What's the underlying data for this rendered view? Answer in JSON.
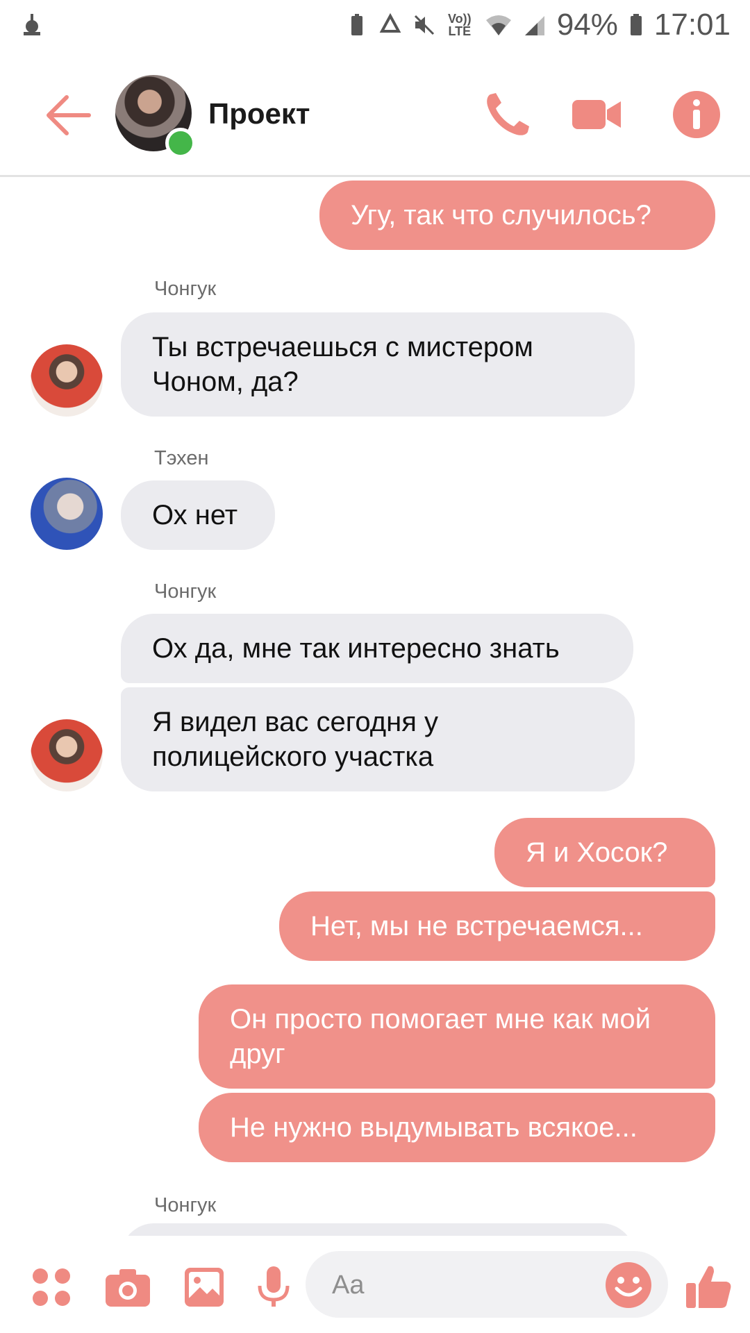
{
  "status_bar": {
    "battery": "94%",
    "time": "17:01",
    "network": "Vo)) LTE"
  },
  "header": {
    "title": "Проект",
    "online": true
  },
  "colors": {
    "accent": "#f0918a",
    "incoming_bubble": "#ebebef",
    "online": "#44b649"
  },
  "messages": [
    {
      "from": "me",
      "text": "Угу, так что случилось?"
    },
    {
      "from": "Чонгук",
      "text": "Ты встречаешься с мистером Чоном, да?"
    },
    {
      "from": "Тэхен",
      "text": "Ох нет"
    },
    {
      "from": "Чонгук",
      "text": "Ох да, мне так интересно знать"
    },
    {
      "from": "Чонгук",
      "text": "Я видел вас сегодня у полицейского участка"
    },
    {
      "from": "me",
      "text": "Я и Хосок?"
    },
    {
      "from": "me",
      "text": "Нет, мы не встречаемся..."
    },
    {
      "from": "me",
      "text": "Он просто помогает мне как мой друг"
    },
    {
      "from": "me",
      "text": "Не нужно выдумывать всякое..."
    },
    {
      "from": "Чонгук",
      "text": ""
    }
  ],
  "senders": {
    "s1": "Чонгук",
    "s2": "Тэхен",
    "s3": "Чонгук",
    "s4": "Чонгук"
  },
  "composer": {
    "placeholder": "Aa"
  },
  "icons": [
    "back-arrow-icon",
    "phone-icon",
    "video-icon",
    "info-icon",
    "apps-icon",
    "camera-icon",
    "gallery-icon",
    "mic-icon",
    "emoji-icon",
    "thumbs-up-icon"
  ]
}
